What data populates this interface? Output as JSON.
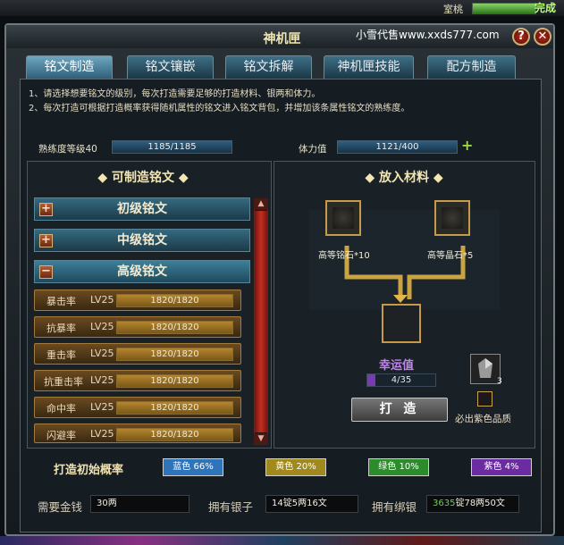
{
  "top": {
    "player_name": "室桃",
    "hp_percent": 1.0,
    "status": "完成"
  },
  "window": {
    "title": "神机匣",
    "watermark": "小雪代售www.xxds777.com",
    "help": "?",
    "close": "✕"
  },
  "tabs": [
    {
      "label": "铭文制造",
      "active": true
    },
    {
      "label": "铭文镶嵌"
    },
    {
      "label": "铭文拆解"
    },
    {
      "label": "神机匣技能"
    },
    {
      "label": "配方制造"
    }
  ],
  "notice": [
    "1、请选择想要铭文的级别，每次打造需要足够的打造材料、银两和体力。",
    "2、每次打造可根据打造概率获得随机属性的铭文进入铭文背包，并增加该条属性铭文的熟练度。"
  ],
  "stats": {
    "skill_label": "熟练度等级40",
    "skill_value": "1185/1185",
    "skill_fraction": 1.0,
    "stamina_label": "体力值",
    "stamina_value": "1121/400",
    "stamina_fraction": 1.0
  },
  "left": {
    "title": "可制造铭文",
    "categories": [
      {
        "label": "初级铭文",
        "icon": "+"
      },
      {
        "label": "中级铭文",
        "icon": "+"
      },
      {
        "label": "高级铭文",
        "icon": "−"
      }
    ],
    "items": [
      {
        "name": "暴击率",
        "level": "LV25",
        "value": "1820/1820",
        "fraction": 1.0
      },
      {
        "name": "抗暴率",
        "level": "LV25",
        "value": "1820/1820",
        "fraction": 1.0
      },
      {
        "name": "重击率",
        "level": "LV25",
        "value": "1820/1820",
        "fraction": 1.0
      },
      {
        "name": "抗重击率",
        "level": "LV25",
        "value": "1820/1820",
        "fraction": 1.0
      },
      {
        "name": "命中率",
        "level": "LV25",
        "value": "1820/1820",
        "fraction": 1.0
      },
      {
        "name": "闪避率",
        "level": "LV25",
        "value": "1820/1820",
        "fraction": 1.0
      }
    ]
  },
  "right": {
    "title": "放入材料",
    "material_a": "高等铭石*10",
    "material_b": "高等晶石*5",
    "luck_label": "幸运值",
    "luck_value": "4/35",
    "luck_fraction": 0.114,
    "make_button": "打 造",
    "gem_count": "3",
    "purple_label": "必出紫色品质"
  },
  "probability": {
    "label": "打造初始概率",
    "blue": {
      "text": "蓝色 66%",
      "color": "#2f73b8"
    },
    "yellow": {
      "text": "黄色 20%",
      "color": "#a08a1e"
    },
    "green": {
      "text": "绿色 10%",
      "color": "#2c8c2c"
    },
    "purple": {
      "text": "紫色 4%",
      "color": "#6a2ca0"
    }
  },
  "money": {
    "need_label": "需要金钱",
    "need_value": "30两",
    "silver_label": "拥有银子",
    "silver_value": "14锭5两16文",
    "bound_label": "拥有绑银",
    "bound_prefix": "3635",
    "bound_suffix": "锭78两50文"
  }
}
